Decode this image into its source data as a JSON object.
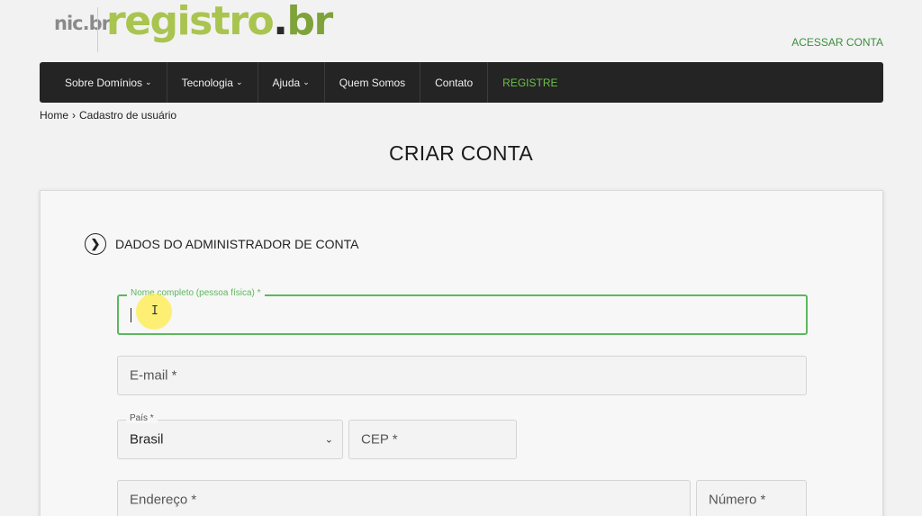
{
  "header": {
    "nic_logo": "nic.br",
    "brand_main": "registro",
    "brand_dot": ".",
    "brand_tld": "br",
    "access_link": "ACESSAR CONTA"
  },
  "nav": {
    "items": [
      {
        "label": "Sobre Domínios",
        "chevron": "⌄"
      },
      {
        "label": "Tecnologia",
        "chevron": "⌄"
      },
      {
        "label": "Ajuda",
        "chevron": "⌄"
      },
      {
        "label": "Quem Somos"
      },
      {
        "label": "Contato"
      },
      {
        "label": "REGISTRE"
      }
    ]
  },
  "breadcrumb": {
    "home": "Home",
    "separator": "›",
    "current": "Cadastro de usuário"
  },
  "page": {
    "title": "CRIAR CONTA"
  },
  "section": {
    "icon": "chevron-right-icon",
    "glyph": "❯",
    "title": "DADOS DO ADMINISTRADOR DE CONTA"
  },
  "form": {
    "full_name": {
      "label": "Nome completo (pessoa física) *",
      "value": ""
    },
    "email": {
      "placeholder": "E-mail *"
    },
    "country": {
      "label": "País *",
      "value": "Brasil",
      "arrow": "⌄"
    },
    "cep": {
      "placeholder": "CEP *"
    },
    "address": {
      "placeholder": "Endereço *"
    },
    "number": {
      "placeholder": "Número *"
    }
  },
  "colors": {
    "accent_green": "#5cb85c",
    "nav_bg": "#242424",
    "brand_green": "#a9c44f"
  }
}
